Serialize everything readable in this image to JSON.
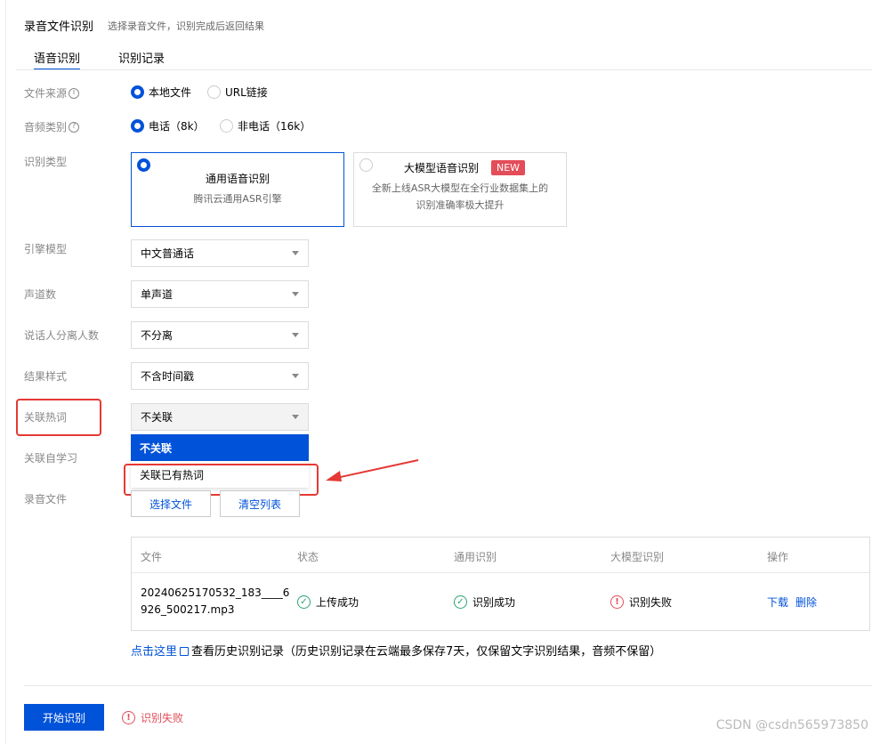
{
  "header": {
    "title": "录音文件识别",
    "subtitle": "选择录音文件，识别完成后返回结果"
  },
  "tabs": [
    {
      "label": "语音识别",
      "active": true
    },
    {
      "label": "识别记录",
      "active": false
    }
  ],
  "form": {
    "file_source": {
      "label": "文件来源",
      "options": [
        {
          "label": "本地文件",
          "selected": true
        },
        {
          "label": "URL链接",
          "selected": false
        }
      ]
    },
    "audio_type": {
      "label": "音频类别",
      "options": [
        {
          "label": "电话（8k）",
          "selected": true
        },
        {
          "label": "非电话（16k）",
          "selected": false
        }
      ]
    },
    "recognition_type": {
      "label": "识别类型",
      "cards": [
        {
          "title": "通用语音识别",
          "desc": "腾讯云通用ASR引擎",
          "selected": true
        },
        {
          "title": "大模型语音识别",
          "badge": "NEW",
          "desc_line1": "全新上线ASR大模型在全行业数据集上的",
          "desc_line2": "识别准确率极大提升",
          "selected": false
        }
      ]
    },
    "engine_model": {
      "label": "引擎模型",
      "value": "中文普通话"
    },
    "channels": {
      "label": "声道数",
      "value": "单声道"
    },
    "speaker_separation": {
      "label": "说话人分离人数",
      "value": "不分离"
    },
    "result_style": {
      "label": "结果样式",
      "value": "不含时间戳"
    },
    "hotwords": {
      "label": "关联热词",
      "value": "不关联",
      "dropdown_open": true,
      "options": [
        "不关联",
        "关联已有热词"
      ]
    },
    "self_learning": {
      "label": "关联自学习"
    },
    "audio_file": {
      "label": "录音文件",
      "choose_button": "选择文件",
      "clear_button": "清空列表"
    }
  },
  "table": {
    "columns": [
      "文件",
      "状态",
      "通用识别",
      "大模型识别",
      "操作"
    ],
    "rows": [
      {
        "file_line1": "20240625170532_183____6",
        "file_line2": "926_500217.mp3",
        "status": "上传成功",
        "general": "识别成功",
        "llm": "识别失败",
        "actions": [
          "下载",
          "删除"
        ]
      }
    ]
  },
  "history_note": {
    "link": "点击这里",
    "text": "查看历史识别记录（历史识别记录在云端最多保存7天，仅保留文字识别结果，音频不保留）"
  },
  "footer": {
    "start_button": "开始识别",
    "error_text": "识别失败"
  },
  "watermark": "CSDN @csdn565973850",
  "colors": {
    "primary": "#0052d9",
    "success": "#2ba471",
    "error": "#e34d59",
    "annotation_red": "#e53935"
  }
}
